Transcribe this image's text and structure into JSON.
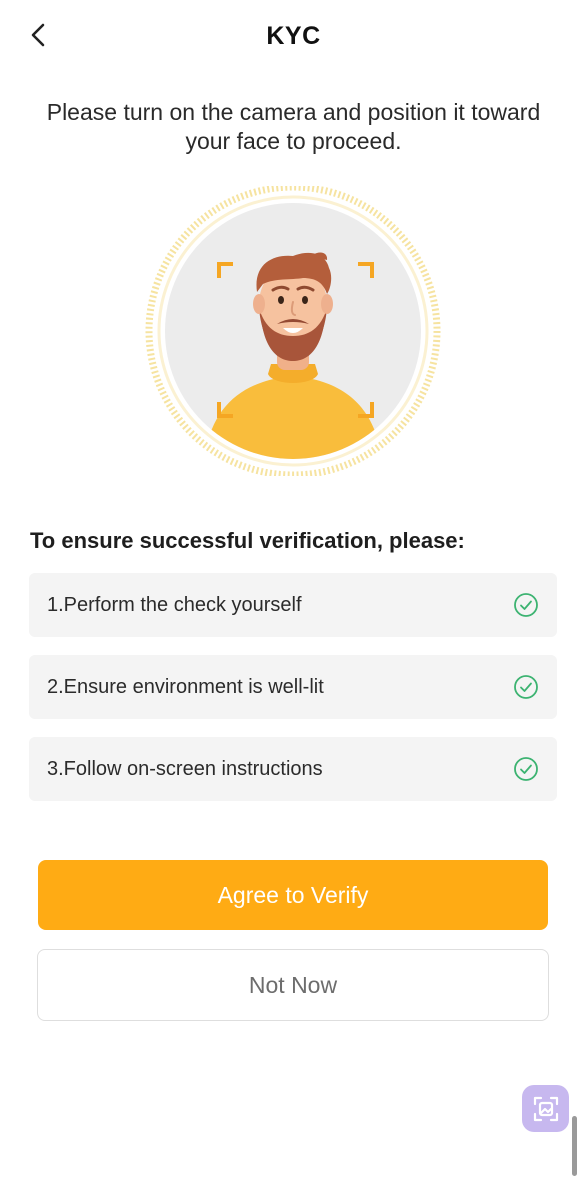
{
  "header": {
    "title": "KYC",
    "back_icon": "chevron-left-icon"
  },
  "instruction": {
    "text": "Please turn on the camera and position it toward your face to proceed."
  },
  "illustration": {
    "subject": "face-scan-avatar-illustration",
    "ring_color": "#f6e3a0",
    "frame_corner_color": "#f5a623",
    "shirt_color": "#f9bd3c"
  },
  "checklist": {
    "heading": "To ensure successful verification, please:",
    "items": [
      {
        "label": "1.Perform the check yourself",
        "icon": "check-circle-icon"
      },
      {
        "label": "2.Ensure environment is well-lit",
        "icon": "check-circle-icon"
      },
      {
        "label": "3.Follow on-screen instructions",
        "icon": "check-circle-icon"
      }
    ],
    "check_color": "#3cb371"
  },
  "actions": {
    "agree_label": "Agree to Verify",
    "not_now_label": "Not Now",
    "accent_color": "#ffab14"
  },
  "floating": {
    "icon": "image-scan-icon",
    "color": "#c7b8ef"
  }
}
